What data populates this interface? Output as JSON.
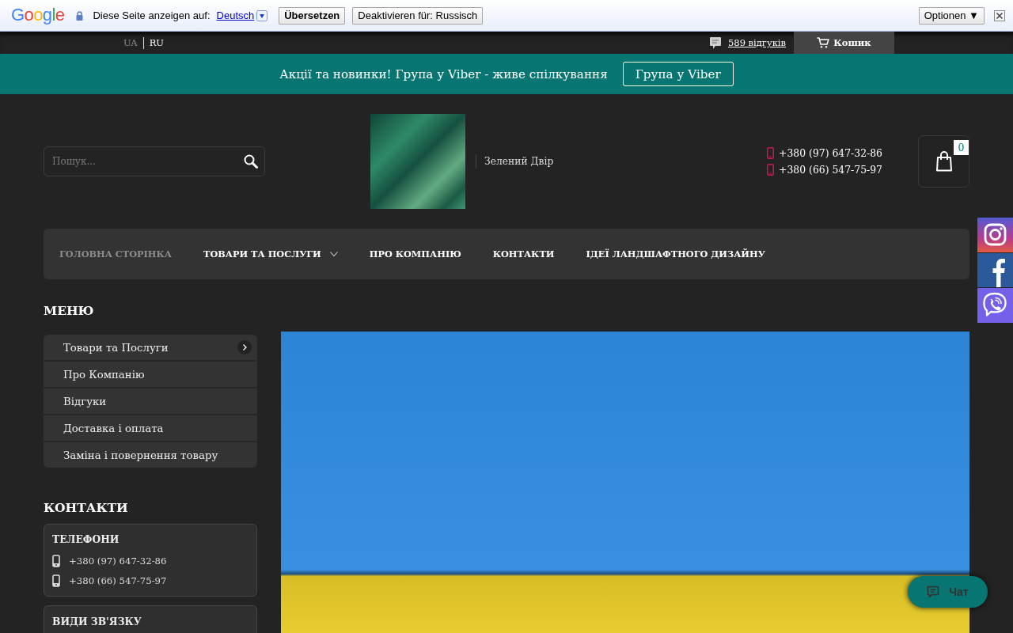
{
  "translate_bar": {
    "logo": "Google",
    "prompt": "Diese Seite anzeigen auf:",
    "language_link": "Deutsch",
    "translate_button": "Übersetzen",
    "disable_button": "Deaktivieren für: Russisch",
    "options_button": "Optionen ▼"
  },
  "top_bar": {
    "languages": [
      {
        "label": "UA",
        "selected": true
      },
      {
        "label": "RU",
        "selected": false
      }
    ],
    "reviews_link": "589 відгуків",
    "cart_link": "Кошик"
  },
  "promo": {
    "text": "Акції та новинки! Група у Viber - живе спілкування",
    "button": "Група у Viber"
  },
  "header": {
    "search": {
      "placeholder": "Пошук..."
    },
    "company_name": "Зелений Двір",
    "phones": [
      "+380 (97) 647-32-86",
      "+380 (66) 547-75-97"
    ],
    "cart_count": "0"
  },
  "nav": [
    {
      "label": "ГОЛОВНА СТОРІНКА",
      "selected": true,
      "has_submenu": false
    },
    {
      "label": "ТОВАРИ ТА ПОСЛУГИ",
      "selected": false,
      "has_submenu": true
    },
    {
      "label": "ПРО КОМПАНІЮ",
      "selected": false,
      "has_submenu": false
    },
    {
      "label": "КОНТАКТИ",
      "selected": false,
      "has_submenu": false
    },
    {
      "label": "ІДЕЇ ЛАНДШАФТНОГО ДИЗАЙНУ",
      "selected": false,
      "has_submenu": false
    }
  ],
  "sidebar": {
    "menu_title": "МЕНЮ",
    "menu_items": [
      {
        "label": "Товари та Послуги",
        "has_submenu": true
      },
      {
        "label": "Про Компанію",
        "has_submenu": false
      },
      {
        "label": "Відгуки",
        "has_submenu": false
      },
      {
        "label": "Доставка і оплата",
        "has_submenu": false
      },
      {
        "label": "Заміна і повернення товару",
        "has_submenu": false
      }
    ],
    "contacts_title": "КОНТАКТИ",
    "contact_cards": [
      {
        "title": "ТЕЛЕФОНИ",
        "phones": [
          "+380 (97) 647-32-86",
          "+380 (66) 547-75-97"
        ]
      },
      {
        "title": "ВИДИ ЗВ'ЯЗКУ"
      }
    ]
  },
  "chat_button": "Чат"
}
